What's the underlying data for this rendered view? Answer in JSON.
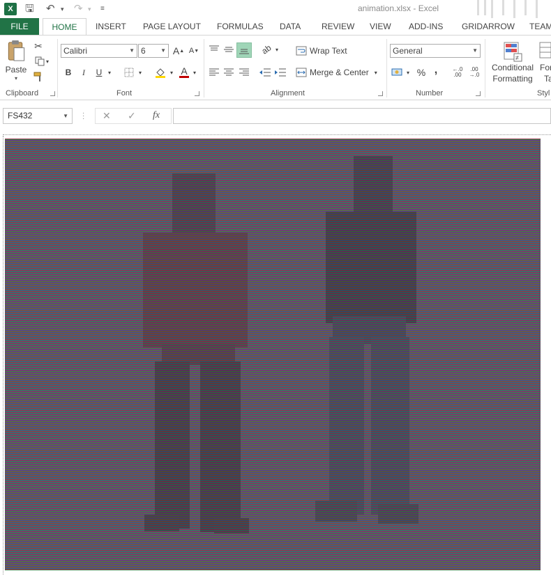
{
  "window": {
    "title": "animation.xlsx - Excel"
  },
  "tabs": [
    "FILE",
    "HOME",
    "INSERT",
    "PAGE LAYOUT",
    "FORMULAS",
    "DATA",
    "REVIEW",
    "VIEW",
    "ADD-INS",
    "GRIDARROW",
    "TEAM"
  ],
  "clipboard": {
    "label": "Clipboard",
    "paste_label": "Paste"
  },
  "font": {
    "label": "Font",
    "name": "Calibri",
    "size": "6",
    "bold": "B",
    "italic": "I",
    "underline": "U",
    "color": "#c00000",
    "fill_color": "#ffd700"
  },
  "alignment": {
    "label": "Alignment",
    "wrap_text": "Wrap Text",
    "merge_center": "Merge & Center"
  },
  "number": {
    "label": "Number",
    "format": "General",
    "percent": "%",
    "comma": ","
  },
  "styles": {
    "label": "Styl",
    "conditional_1": "Conditional",
    "conditional_2": "Formatting",
    "format_as_table_1": "For",
    "format_as_table_2": "Ta"
  },
  "formula_bar": {
    "name_box": "FS432",
    "fx": "fx",
    "formula": ""
  },
  "colors": {
    "accent": "#217346"
  }
}
